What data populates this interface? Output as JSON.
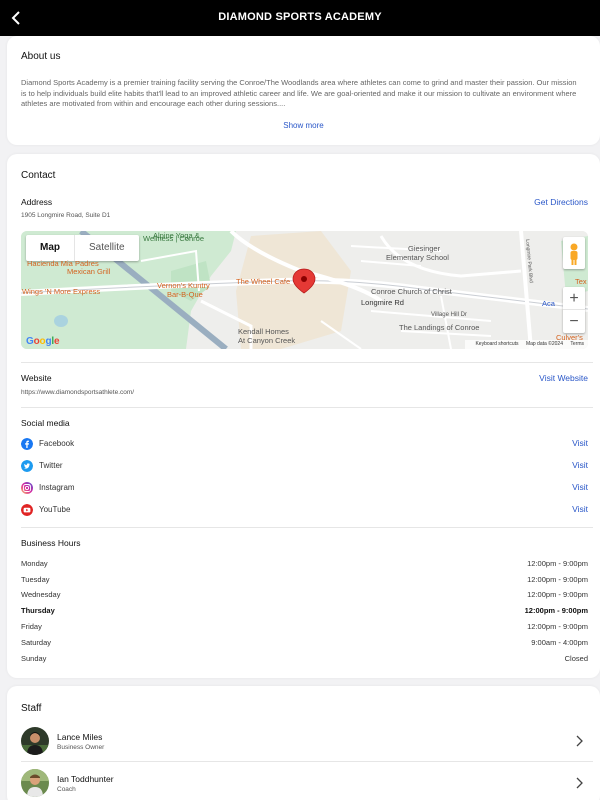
{
  "header": {
    "title": "DIAMOND SPORTS ACADEMY"
  },
  "about": {
    "heading": "About us",
    "text": "Diamond Sports Academy is a premier training facility serving the Conroe/The Woodlands area where athletes can come to grind and master their passion. Our mission is to help individuals build elite habits that'll lead to an improved athletic career and life. We are goal-oriented and make it our mission to cultivate an environment where athletes are motivated from within and encourage each other during sessions....",
    "show_more": "Show more"
  },
  "contact": {
    "heading": "Contact",
    "address_label": "Address",
    "address": "1905 Longmire Road, Suite D1",
    "directions": "Get Directions",
    "map": {
      "tab_map": "Map",
      "tab_satellite": "Satellite",
      "labels": {
        "alpine_yoga": "Alpine Yoga &",
        "wellness": "Wellness | Conroe",
        "hacienda": "Hacienda Mia Padres",
        "mexican": "Mexican Grill",
        "wings": "Wings 'N More Express",
        "vernons1": "Vernon's Kuntry",
        "vernons2": "Bar-B-Que",
        "wheel_cafe": "The Wheel Cafe",
        "giesinger1": "Giesinger",
        "giesinger2": "Elementary School",
        "conroe_church": "Conroe Church of Christ",
        "longmire_rd": "Longmire Rd",
        "village_hill": "Village Hill Dr",
        "landings": "The Landings of Conroe",
        "kendall1": "Kendall Homes",
        "kendall2": "At Canyon Creek",
        "park_blvd": "Longmire Park Blvd",
        "aca": "Aca",
        "tex": "Tex",
        "culvers": "Culver's",
        "google": "Google",
        "shortcuts": "Keyboard shortcuts",
        "map_data": "Map data ©2024",
        "terms": "Terms"
      },
      "zoom_in": "+",
      "zoom_out": "−"
    },
    "website_label": "Website",
    "website_url": "https://www.diamondsportsathlete.com/",
    "visit_website": "Visit Website",
    "social_heading": "Social media",
    "social": [
      {
        "name": "Facebook",
        "visit": "Visit",
        "icon": "facebook-icon",
        "color": "#1877f2"
      },
      {
        "name": "Twitter",
        "visit": "Visit",
        "icon": "twitter-icon",
        "color": "#1d9bf0"
      },
      {
        "name": "Instagram",
        "visit": "Visit",
        "icon": "instagram-icon",
        "color": "#d6249f"
      },
      {
        "name": "YouTube",
        "visit": "Visit",
        "icon": "youtube-icon",
        "color": "#e02424"
      }
    ],
    "hours_heading": "Business Hours",
    "hours": [
      {
        "day": "Monday",
        "time": "12:00pm - 9:00pm"
      },
      {
        "day": "Tuesday",
        "time": "12:00pm - 9:00pm"
      },
      {
        "day": "Wednesday",
        "time": "12:00pm - 9:00pm"
      },
      {
        "day": "Thursday",
        "time": "12:00pm - 9:00pm"
      },
      {
        "day": "Friday",
        "time": "12:00pm - 9:00pm"
      },
      {
        "day": "Saturday",
        "time": "9:00am - 4:00pm"
      },
      {
        "day": "Sunday",
        "time": "Closed"
      }
    ]
  },
  "staff": {
    "heading": "Staff",
    "members": [
      {
        "name": "Lance Miles",
        "role": "Business Owner"
      },
      {
        "name": "Ian Toddhunter",
        "role": "Coach"
      }
    ]
  },
  "colors": {
    "accent_link": "#2a57c8",
    "header_bg": "#000000",
    "map_pin": "#e53935"
  }
}
